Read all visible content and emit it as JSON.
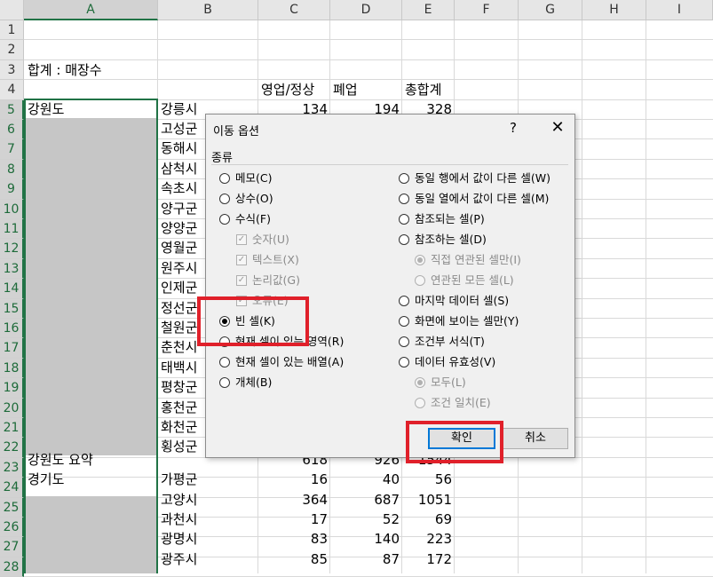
{
  "sheet": {
    "columns": [
      "A",
      "B",
      "C",
      "D",
      "E",
      "F",
      "G",
      "H",
      "I"
    ],
    "rows": [
      "1",
      "2",
      "3",
      "4",
      "5",
      "6",
      "7",
      "8",
      "9",
      "10",
      "11",
      "12",
      "13",
      "14",
      "15",
      "16",
      "17",
      "18",
      "19",
      "20",
      "21",
      "22",
      "23",
      "24",
      "25",
      "26",
      "27",
      "28"
    ],
    "selected_column": "A",
    "title_cell": "합계 : 매장수",
    "headers": {
      "c": "영업/정상",
      "d": "폐업",
      "e": "총합계"
    },
    "row5": {
      "a": "강원도",
      "b": "강릉시",
      "c": "134",
      "d": "194",
      "e": "328"
    },
    "b_cities": [
      "고성군",
      "동해시",
      "삼척시",
      "속초시",
      "양구군",
      "양양군",
      "영월군",
      "원주시",
      "인제군",
      "정선군",
      "철원군",
      "춘천시",
      "태백시",
      "평창군",
      "홍천군",
      "화천군",
      "횡성군"
    ],
    "row23": {
      "a": "강원도 요약",
      "c": "618",
      "d": "926",
      "e": "1544"
    },
    "row24": {
      "a": "경기도",
      "b": "가평군",
      "c": "16",
      "d": "40",
      "e": "56"
    },
    "row25": {
      "b": "고양시",
      "c": "364",
      "d": "687",
      "e": "1051"
    },
    "row26": {
      "b": "과천시",
      "c": "17",
      "d": "52",
      "e": "69"
    },
    "row27": {
      "b": "광명시",
      "c": "83",
      "d": "140",
      "e": "223"
    },
    "row28": {
      "b": "광주시",
      "c": "85",
      "d": "87",
      "e": "172"
    }
  },
  "dialog": {
    "title": "이동 옵션",
    "help": "?",
    "close": "✕",
    "group_label": "종류",
    "left_options": [
      {
        "label": "메모(C)",
        "kind": "radio"
      },
      {
        "label": "상수(O)",
        "kind": "radio"
      },
      {
        "label": "수식(F)",
        "kind": "radio"
      },
      {
        "label": "숫자(U)",
        "kind": "check"
      },
      {
        "label": "텍스트(X)",
        "kind": "check"
      },
      {
        "label": "논리값(G)",
        "kind": "check"
      },
      {
        "label": "오류(E)",
        "kind": "check"
      },
      {
        "label": "빈 셀(K)",
        "kind": "radio",
        "checked": true
      },
      {
        "label": "현재 셀이 있는 영역(R)",
        "kind": "radio"
      },
      {
        "label": "현재 셀이 있는 배열(A)",
        "kind": "radio"
      },
      {
        "label": "개체(B)",
        "kind": "radio"
      }
    ],
    "right_options": [
      {
        "label": "동일 행에서 값이 다른 셀(W)",
        "kind": "radio"
      },
      {
        "label": "동일 열에서 값이 다른 셀(M)",
        "kind": "radio"
      },
      {
        "label": "참조되는 셀(P)",
        "kind": "radio"
      },
      {
        "label": "참조하는 셀(D)",
        "kind": "radio"
      },
      {
        "label": "직접 연관된 셀만(I)",
        "kind": "subradio",
        "checked": true
      },
      {
        "label": "연관된 모든 셀(L)",
        "kind": "subradio"
      },
      {
        "label": "마지막 데이터 셀(S)",
        "kind": "radio"
      },
      {
        "label": "화면에 보이는 셀만(Y)",
        "kind": "radio"
      },
      {
        "label": "조건부 서식(T)",
        "kind": "radio"
      },
      {
        "label": "데이터 유효성(V)",
        "kind": "radio"
      },
      {
        "label": "모두(L)",
        "kind": "subradio",
        "checked": true
      },
      {
        "label": "조건 일치(E)",
        "kind": "subradio"
      }
    ],
    "ok_label": "확인",
    "cancel_label": "취소",
    "highlight_color": "#e0202a"
  }
}
